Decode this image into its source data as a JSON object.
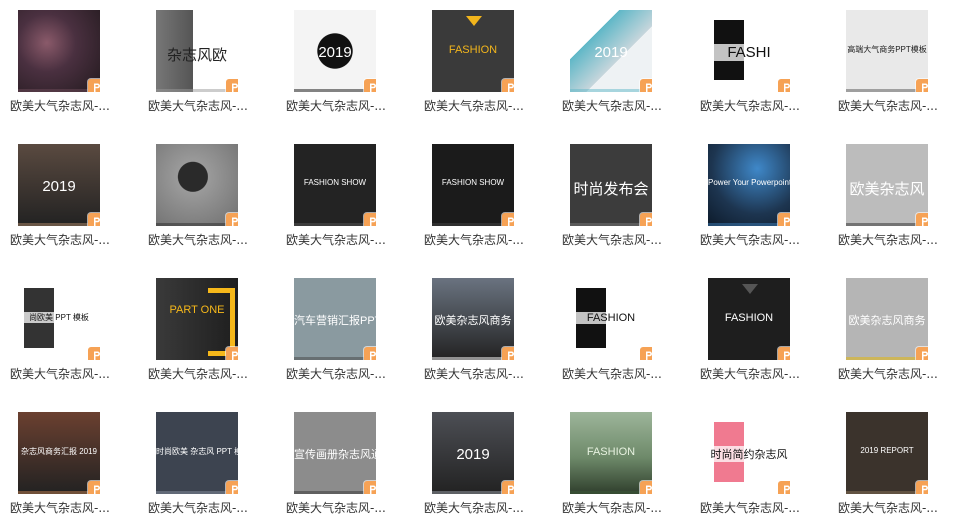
{
  "file_type_icon": "ppt-file-icon",
  "badge_color": "#f6a255",
  "items": [
    {
      "caption": "欧美大气杂志风-...",
      "title": "",
      "bg": "#2e2226",
      "fg": "#d8c0c8",
      "accent": "#6b4a58",
      "style": "photo"
    },
    {
      "caption": "欧美大气杂志风-...",
      "title": "杂志风欧",
      "bg": "#ffffff",
      "fg": "#222222",
      "accent": "#9a9a9a",
      "style": "split"
    },
    {
      "caption": "欧美大气杂志风-...",
      "title": "2019",
      "bg": "#f4f4f4",
      "fg": "#ffffff",
      "accent": "#111111",
      "style": "splash"
    },
    {
      "caption": "欧美大气杂志风-...",
      "title": "FASHION",
      "bg": "#3a3a3a",
      "fg": "#f2b51c",
      "accent": "#f2b51c",
      "style": "dark"
    },
    {
      "caption": "欧美大气杂志风-...",
      "title": "2019",
      "bg": "#dfe6ea",
      "fg": "#ffffff",
      "accent": "#5fb7c7",
      "style": "diag"
    },
    {
      "caption": "欧美大气杂志风-...",
      "title": "FASHI",
      "bg": "#ffffff",
      "fg": "#111111",
      "accent": "#111111",
      "style": "bw"
    },
    {
      "caption": "欧美大气杂志风-...",
      "title": "高端大气商务PPT模板",
      "bg": "#e9e9e9",
      "fg": "#222222",
      "accent": "#555555",
      "style": "light"
    },
    {
      "caption": "欧美大气杂志风-...",
      "title": "2019",
      "bg": "#5a4a40",
      "fg": "#ffffff",
      "accent": "#b08a6a",
      "style": "city"
    },
    {
      "caption": "欧美大气杂志风-...",
      "title": "",
      "bg": "#7d7d7d",
      "fg": "#ffffff",
      "accent": "#2b2b2b",
      "style": "portrait"
    },
    {
      "caption": "欧美大气杂志风-...",
      "title": "FASHION SHOW",
      "bg": "#232323",
      "fg": "#ffffff",
      "accent": "#555555",
      "style": "dark"
    },
    {
      "caption": "欧美大气杂志风-...",
      "title": "FASHION SHOW",
      "bg": "#1b1b1b",
      "fg": "#ffffff",
      "accent": "#444444",
      "style": "dark"
    },
    {
      "caption": "欧美大气杂志风-...",
      "title": "时尚发布会",
      "bg": "#3c3c3c",
      "fg": "#ffffff",
      "accent": "#777777",
      "style": "dark"
    },
    {
      "caption": "欧美大气杂志风-...",
      "title": "Power Your Powerpoint",
      "bg": "#1d3550",
      "fg": "#ffffff",
      "accent": "#3c7bb5",
      "style": "blue"
    },
    {
      "caption": "欧美大气杂志风-...",
      "title": "欧美杂志风",
      "bg": "#bcbcbc",
      "fg": "#ffffff",
      "accent": "#2a2a2a",
      "style": "light"
    },
    {
      "caption": "欧美大气杂志风-...",
      "title": "尚欧美 PPT 模板",
      "bg": "#ffffff",
      "fg": "#111111",
      "accent": "#333333",
      "style": "bw"
    },
    {
      "caption": "欧美大气杂志风-...",
      "title": "PART ONE",
      "bg": "#2a2a2a",
      "fg": "#f6b81a",
      "accent": "#f6b81a",
      "style": "yellow"
    },
    {
      "caption": "欧美大气杂志风-...",
      "title": "汽车营销汇报PPT",
      "bg": "#8a9aa0",
      "fg": "#ffffff",
      "accent": "#444444",
      "style": "light"
    },
    {
      "caption": "欧美大气杂志风-...",
      "title": "欧美杂志风商务",
      "bg": "#6a7380",
      "fg": "#ffffff",
      "accent": "#ffffff",
      "style": "city"
    },
    {
      "caption": "欧美大气杂志风-...",
      "title": "FASHION",
      "bg": "#ffffff",
      "fg": "#111111",
      "accent": "#111111",
      "style": "bw"
    },
    {
      "caption": "欧美大气杂志风-...",
      "title": "FASHION",
      "bg": "#1e1e1e",
      "fg": "#ffffff",
      "accent": "#555555",
      "style": "dark"
    },
    {
      "caption": "欧美大气杂志风-...",
      "title": "欧美杂志风商务",
      "bg": "#b5b5b5",
      "fg": "#ffffff",
      "accent": "#e6b800",
      "style": "light"
    },
    {
      "caption": "欧美大气杂志风-...",
      "title": "杂志风商务汇报 2019",
      "bg": "#6b4030",
      "fg": "#ffffff",
      "accent": "#c08050",
      "style": "city"
    },
    {
      "caption": "欧美大气杂志风-...",
      "title": "时尚欧美 杂志风 PPT 模板",
      "bg": "#3d4450",
      "fg": "#ffffff",
      "accent": "#8890a0",
      "style": "dark"
    },
    {
      "caption": "欧美大气杂志风-...",
      "title": "宣传画册杂志风通用",
      "bg": "#8c8c8c",
      "fg": "#ffffff",
      "accent": "#333333",
      "style": "light"
    },
    {
      "caption": "欧美大气杂志风-...",
      "title": "2019",
      "bg": "#4d4f55",
      "fg": "#ffffff",
      "accent": "#9aa0a8",
      "style": "city"
    },
    {
      "caption": "欧美大气杂志风-...",
      "title": "FASHION",
      "bg": "#6e8a6a",
      "fg": "#e7f2e0",
      "accent": "#3b5a38",
      "style": "green"
    },
    {
      "caption": "欧美大气杂志风-...",
      "title": "时尚简约杂志风",
      "bg": "#ffffff",
      "fg": "#222222",
      "accent": "#f07a90",
      "style": "bw"
    },
    {
      "caption": "欧美大气杂志风-...",
      "title": "2019 REPORT",
      "bg": "#3b332c",
      "fg": "#ffffff",
      "accent": "#8a7358",
      "style": "dark"
    }
  ]
}
